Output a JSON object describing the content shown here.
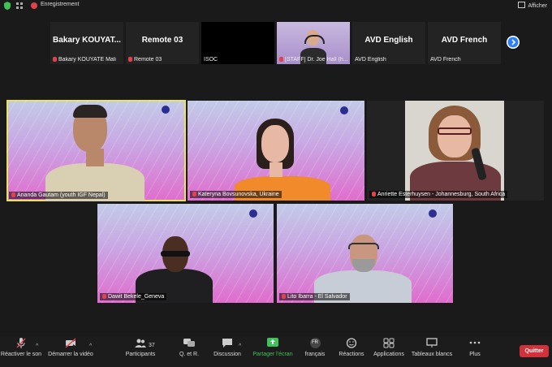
{
  "topbar": {
    "recording_label": "Enregistrement",
    "view_label": "Afficher"
  },
  "strip": [
    {
      "big": "Bakary KOUYAT...",
      "label": "Bakary KOUYATE Mali",
      "muted": true
    },
    {
      "big": "Remote 03",
      "label": "Remote 03",
      "muted": true
    },
    {
      "big": "",
      "label": "ISOC",
      "muted": false
    },
    {
      "big": "",
      "label": "[STAFF] Dr. Joe Hall (h...",
      "muted": true
    },
    {
      "big": "AVD English",
      "label": "AVD English",
      "muted": false
    },
    {
      "big": "AVD French",
      "label": "AVD French",
      "muted": false
    }
  ],
  "grid": [
    {
      "name": "Ananda Gautam (youth IGF Nepal)"
    },
    {
      "name": "Kateryna Bovsunovska, Ukraine"
    },
    {
      "name": "Anriette Esterhuysen - Johannesburg, South Africa"
    },
    {
      "name": "Dawit Bekele_Geneva"
    },
    {
      "name": "Lito Ibarra - El Salvador"
    }
  ],
  "toolbar": {
    "unmute": "Réactiver le son",
    "start_video": "Démarrer la vidéo",
    "participants": "Participants",
    "participants_count": "37",
    "qa": "Q. et R.",
    "chat": "Discussion",
    "share": "Partager l'écran",
    "language_badge": "FR",
    "language": "français",
    "reactions": "Réactions",
    "apps": "Applications",
    "whiteboards": "Tableaux blancs",
    "more": "Plus",
    "quit": "Quitter"
  },
  "colors": {
    "share_green": "#3ec35a",
    "quit_red": "#d0313a",
    "active_speaker": "#e8e35a"
  }
}
